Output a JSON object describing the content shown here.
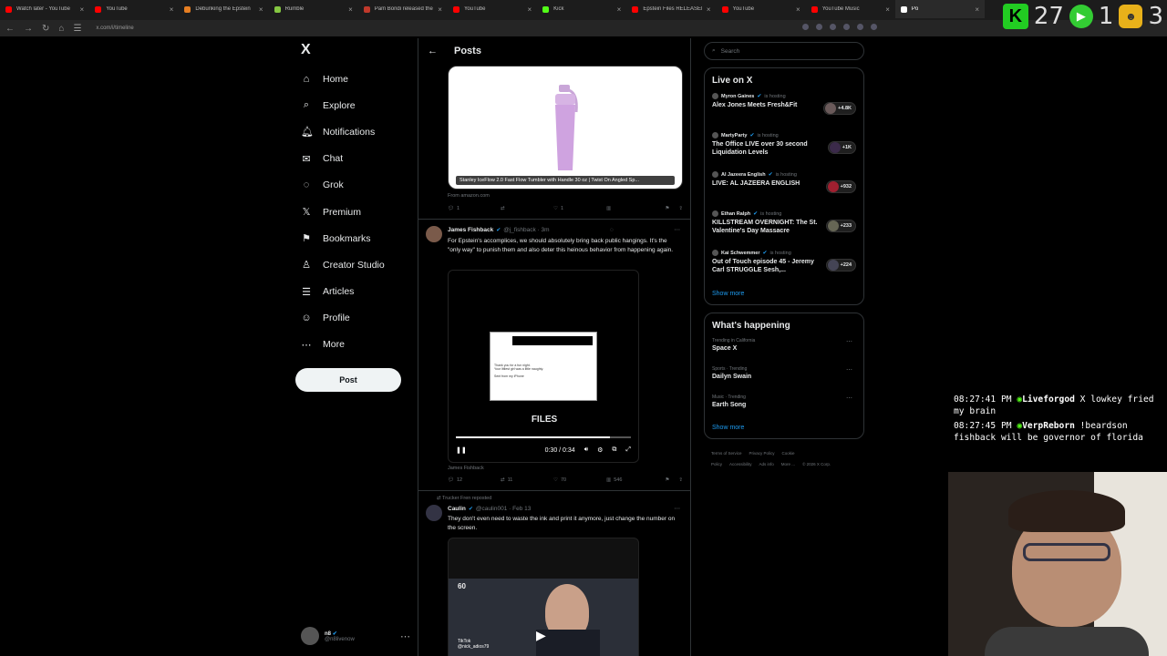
{
  "browser": {
    "tabs": [
      {
        "title": "Watch later - YouTube",
        "color": "#ff0000"
      },
      {
        "title": "YouTube",
        "color": "#ff0000"
      },
      {
        "title": "Debunking the Epstein",
        "color": "#e67e22"
      },
      {
        "title": "Rumble",
        "color": "#85c742"
      },
      {
        "title": "Pam Bondi released the",
        "color": "#c0392b"
      },
      {
        "title": "YouTube",
        "color": "#ff0000"
      },
      {
        "title": "Kick",
        "color": "#53fc18"
      },
      {
        "title": "Epstein Files RELEASED! A",
        "color": "#ff0000"
      },
      {
        "title": "YouTube",
        "color": "#ff0000"
      },
      {
        "title": "YouTube Music",
        "color": "#ff0000"
      },
      {
        "title": "Po",
        "color": "#ffffff"
      }
    ],
    "url": "x.com/i/timeline",
    "overlay_counts": [
      "27",
      "1",
      "3"
    ]
  },
  "nav": {
    "logo": "X",
    "items": [
      {
        "label": "Home",
        "icon": "⌂",
        "name": "home"
      },
      {
        "label": "Explore",
        "icon": "⌕",
        "name": "explore"
      },
      {
        "label": "Notifications",
        "icon": "🔔︎",
        "name": "notifications"
      },
      {
        "label": "Chat",
        "icon": "✉",
        "name": "chat"
      },
      {
        "label": "Grok",
        "icon": "◌",
        "name": "grok"
      },
      {
        "label": "Premium",
        "icon": "𝕏",
        "name": "premium"
      },
      {
        "label": "Bookmarks",
        "icon": "⚑",
        "name": "bookmarks"
      },
      {
        "label": "Creator Studio",
        "icon": "♙",
        "name": "creator-studio"
      },
      {
        "label": "Articles",
        "icon": "☰",
        "name": "articles"
      },
      {
        "label": "Profile",
        "icon": "☺",
        "name": "profile"
      },
      {
        "label": "More",
        "icon": "⋯",
        "name": "more"
      }
    ],
    "post_label": "Post",
    "account": {
      "name": "n8",
      "handle": "@n8livenow"
    }
  },
  "feed": {
    "header": "Posts",
    "card": {
      "caption": "Stanley IceFlow 2.0 Fast Flow Tumbler with Handle 30 oz | Twist On Angled Sp...",
      "from": "From amazon.com",
      "replies": "1",
      "likes": "1"
    },
    "tweet1": {
      "name": "James Fishback",
      "handle": "@j_fishback · 3m",
      "text": "For Epstein's accomplices, we should absolutely bring back public hangings. It's the \"only way\" to punish them and also deter this heinous behavior from happening again.",
      "video_title": "FILES",
      "doc_line1": "Thank you for a fun night.",
      "doc_line2": "Your littlest girl was a little naughty.",
      "doc_line3": "Sent from my iPhone",
      "time": "0:30 / 0:34",
      "progress": 0.88,
      "author": "James Fishback",
      "replies": "12",
      "reposts": "11",
      "likes": "70",
      "views": "546"
    },
    "tweet2": {
      "repost": "Trucker Fren reposted",
      "name": "Caulin",
      "handle": "@caulin001 · Feb 13",
      "text": "They don't even need to waste the ink and print it anymore, just change the number on the screen.",
      "tiktok": "TikTok",
      "tiktok_handle": "@nick_adios79",
      "badge": "60"
    }
  },
  "right": {
    "search_placeholder": "Search",
    "live_title": "Live on X",
    "live": [
      {
        "host": "Myron Gaines",
        "title": "Alex Jones Meets Fresh&Fit",
        "count": "+4.8K"
      },
      {
        "host": "MartyParty",
        "title": "The Office LIVE over 30 second Liquidation Levels",
        "count": "+1K"
      },
      {
        "host": "Al Jazeera English",
        "title": "LIVE: AL JAZEERA ENGLISH",
        "count": "+932"
      },
      {
        "host": "Ethan Ralph",
        "title": "KILLSTREAM OVERNIGHT: The St. Valentine's Day Massacre",
        "count": "+233"
      },
      {
        "host": "Kai Schwemmer",
        "title": "Out of Touch episode 45 - Jeremy Carl STRUGGLE Sesh,...",
        "count": "+224"
      }
    ],
    "hosting": "is hosting",
    "show_more": "Show more",
    "happening_title": "What's happening",
    "trends": [
      {
        "category": "Trending in California",
        "name": "Space X"
      },
      {
        "category": "Sports · Trending",
        "name": "Dailyn Swain"
      },
      {
        "category": "Music · Trending",
        "name": "Earth Song"
      }
    ],
    "footer": [
      "Terms of Service",
      "Privacy Policy",
      "Cookie Policy",
      "Accessibility",
      "Ads info",
      "More ...",
      "© 2026 X Corp."
    ]
  },
  "chat": [
    {
      "time": "08:27:41 PM",
      "user": "Liveforgod",
      "text": "X lowkey fried my brain"
    },
    {
      "time": "08:27:45 PM",
      "user": "VerpReborn",
      "text": "!beardson fishback will be governor of florida"
    }
  ]
}
